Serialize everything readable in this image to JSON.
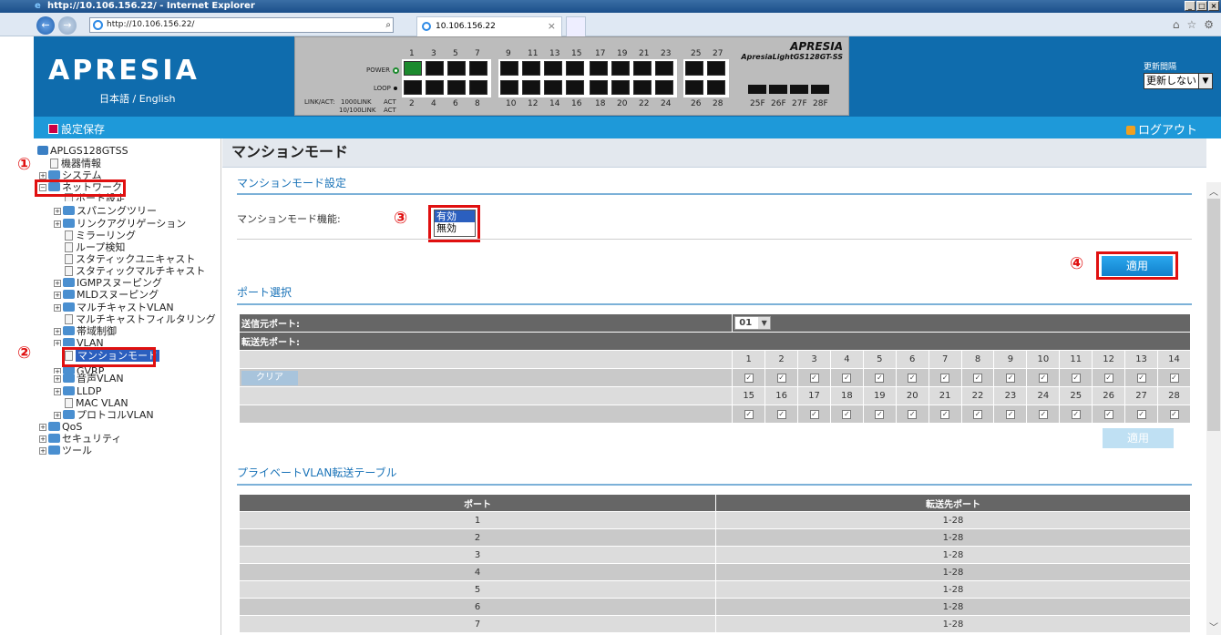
{
  "browser": {
    "title": "http://10.106.156.22/ - Internet Explorer",
    "address": "http://10.106.156.22/",
    "tab_label": "10.106.156.22",
    "tab_close": "×",
    "win_min": "_",
    "win_max": "□",
    "win_close": "×",
    "back_glyph": "←",
    "fwd_glyph": "→",
    "search_glyph": "⌕",
    "tools": [
      "⌂",
      "☆",
      "⚙"
    ]
  },
  "header": {
    "logo": "APRESIA",
    "lang_ja": "日本語",
    "lang_sep": " / ",
    "lang_en": "English",
    "refresh_label": "更新間隔",
    "refresh_value": "更新しない",
    "model_brand": "APRESIA",
    "model_name": "ApresiaLightGS128GT-SS",
    "panel_labels": {
      "power": "POWER",
      "loop": "LOOP",
      "linkact": "LINK/ACT:",
      "l1000": "1000LINK",
      "l10": "10/100LINK",
      "act1": "ACT",
      "act2": "ACT"
    },
    "top_numbers": [
      "1",
      "3",
      "5",
      "7",
      "9",
      "11",
      "13",
      "15",
      "17",
      "19",
      "21",
      "23",
      "25",
      "27"
    ],
    "bottom_numbers": [
      "2",
      "4",
      "6",
      "8",
      "10",
      "12",
      "14",
      "16",
      "18",
      "20",
      "22",
      "24",
      "26",
      "28"
    ],
    "sfp_labels": [
      "25F",
      "26F",
      "27F",
      "28F"
    ]
  },
  "savebar": {
    "save": "設定保存",
    "logout": "ログアウト"
  },
  "tree": {
    "root": "APLGS128GTSS",
    "items": {
      "device": "機器情報",
      "system": "システム",
      "network": "ネットワーク",
      "port": "ポート設定",
      "stp": "スパニングツリー",
      "lag": "リンクアグリゲーション",
      "mirror": "ミラーリング",
      "loop": "ループ検知",
      "sunicast": "スタティックユニキャスト",
      "smulticast": "スタティックマルチキャスト",
      "igmp": "IGMPスヌーピング",
      "mld": "MLDスヌーピング",
      "mvlan": "マルチキャストVLAN",
      "mfilter": "マルチキャストフィルタリング",
      "bw": "帯域制御",
      "vlan": "VLAN",
      "mansion": "マンションモード",
      "gvrp": "GVRP",
      "voice": "音声VLAN",
      "lldp": "LLDP",
      "macvlan": "MAC VLAN",
      "protovlan": "プロトコルVLAN",
      "qos": "QoS",
      "security": "セキュリティ",
      "tools": "ツール"
    }
  },
  "annotations": [
    "①",
    "②",
    "③",
    "④"
  ],
  "page": {
    "title": "マンションモード",
    "sec1": "マンションモード設定",
    "func_label": "マンションモード機能:",
    "options": [
      "有効",
      "無効"
    ],
    "apply": "適用",
    "sec2": "ポート選択",
    "src_label": "送信元ポート:",
    "src_value": "01",
    "dst_label": "転送先ポート:",
    "clear": "クリア",
    "ports_row1": [
      "1",
      "2",
      "3",
      "4",
      "5",
      "6",
      "7",
      "8",
      "9",
      "10",
      "11",
      "12",
      "13",
      "14"
    ],
    "ports_row2": [
      "15",
      "16",
      "17",
      "18",
      "19",
      "20",
      "21",
      "22",
      "23",
      "24",
      "25",
      "26",
      "27",
      "28"
    ],
    "check": "☑",
    "apply2": "適用",
    "sec3": "プライベートVLAN転送テーブル",
    "vt_headers": [
      "ポート",
      "転送先ポート"
    ],
    "vt_rows": [
      [
        "1",
        "1-28"
      ],
      [
        "2",
        "1-28"
      ],
      [
        "3",
        "1-28"
      ],
      [
        "4",
        "1-28"
      ],
      [
        "5",
        "1-28"
      ],
      [
        "6",
        "1-28"
      ],
      [
        "7",
        "1-28"
      ]
    ]
  },
  "scroll": {
    "up": "︿",
    "down": "﹀"
  }
}
